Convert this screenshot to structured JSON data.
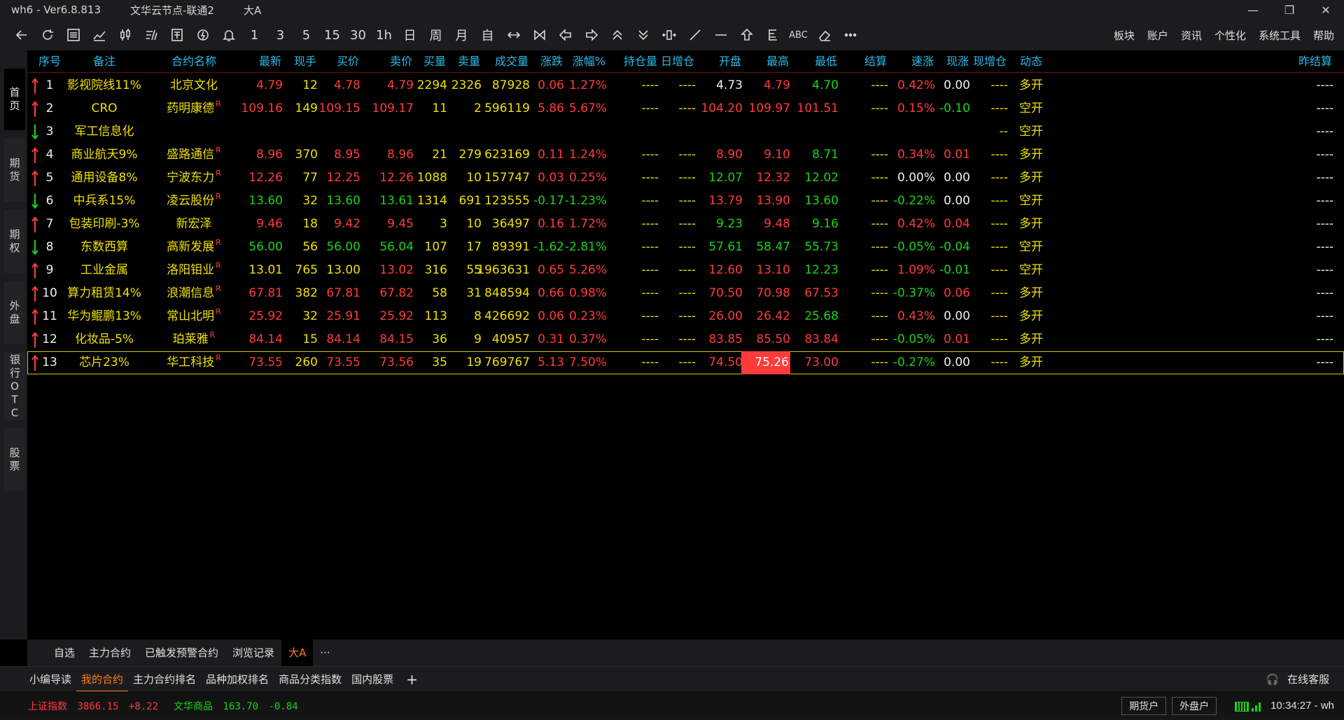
{
  "titlebar": {
    "app": "wh6 - Ver6.8.813",
    "node": "文华云节点-联通2",
    "group": "大A",
    "minimize": "—",
    "maximize": "❐",
    "close": "✕"
  },
  "toolbar": {
    "numeric_buttons": [
      "1",
      "3",
      "5",
      "15",
      "30",
      "1h",
      "日",
      "周",
      "月",
      "自"
    ],
    "text_button": "ABC",
    "menu": [
      "板块",
      "账户",
      "资讯",
      "个性化",
      "系统工具",
      "帮助"
    ]
  },
  "sidetabs": [
    "首页",
    "期货",
    "期权",
    "外盘",
    "银行OTC",
    "股票"
  ],
  "table": {
    "headers": [
      "序号",
      "备注",
      "合约名称",
      "最新",
      "现手",
      "买价",
      "卖价",
      "买量",
      "卖量",
      "成交量",
      "涨跌",
      "涨幅%",
      "持仓量",
      "日增仓",
      "开盘",
      "最高",
      "最低",
      "结算",
      "速涨",
      "现涨",
      "现增仓",
      "动态",
      "昨结算"
    ],
    "rows": [
      {
        "dir": "up",
        "no": "1",
        "note": "影视院线11%",
        "name": "北京文化",
        "r": false,
        "last": "4.79",
        "vol_now": "12",
        "bid": "4.78",
        "ask": "4.79",
        "bidv": "2294",
        "askv": "2326",
        "volume": "87928",
        "chg": "0.06",
        "pct": "1.27%",
        "oi": "----",
        "oi_chg": "----",
        "open": "4.73",
        "high": "4.79",
        "low": "4.70",
        "settle": "----",
        "speed": "0.42%",
        "now_chg": "0.00",
        "now_oi": "----",
        "dyn": "多开",
        "pre": "----",
        "c": {
          "last": "red",
          "bid": "red",
          "ask": "red",
          "chg": "red",
          "pct": "red",
          "open": "wht",
          "high": "red",
          "low": "green",
          "speed": "red",
          "now_chg": "wht"
        }
      },
      {
        "dir": "up",
        "no": "2",
        "note": "CRO",
        "name": "药明康德",
        "r": true,
        "last": "109.16",
        "vol_now": "149",
        "bid": "109.15",
        "ask": "109.17",
        "bidv": "11",
        "askv": "2",
        "volume": "596119",
        "chg": "5.86",
        "pct": "5.67%",
        "oi": "----",
        "oi_chg": "----",
        "open": "104.20",
        "high": "109.97",
        "low": "101.51",
        "settle": "----",
        "speed": "0.15%",
        "now_chg": "-0.10",
        "now_oi": "----",
        "dyn": "空开",
        "pre": "----",
        "c": {
          "last": "red",
          "bid": "red",
          "ask": "red",
          "chg": "red",
          "pct": "red",
          "open": "red",
          "high": "red",
          "low": "red",
          "speed": "red",
          "now_chg": "green"
        }
      },
      {
        "dir": "down",
        "no": "3",
        "note": "军工信息化",
        "name": "",
        "r": false,
        "last": "",
        "vol_now": "",
        "bid": "",
        "ask": "",
        "bidv": "",
        "askv": "",
        "volume": "",
        "chg": "",
        "pct": "",
        "oi": "",
        "oi_chg": "",
        "open": "",
        "high": "",
        "low": "",
        "settle": "",
        "speed": "",
        "now_chg": "",
        "now_oi": "--",
        "dyn": "空开",
        "pre": "----",
        "c": {}
      },
      {
        "dir": "up",
        "no": "4",
        "note": "商业航天9%",
        "name": "盛路通信",
        "r": true,
        "last": "8.96",
        "vol_now": "370",
        "bid": "8.95",
        "ask": "8.96",
        "bidv": "21",
        "askv": "279",
        "volume": "623169",
        "chg": "0.11",
        "pct": "1.24%",
        "oi": "----",
        "oi_chg": "----",
        "open": "8.90",
        "high": "9.10",
        "low": "8.71",
        "settle": "----",
        "speed": "0.34%",
        "now_chg": "0.01",
        "now_oi": "----",
        "dyn": "多开",
        "pre": "----",
        "c": {
          "last": "red",
          "bid": "red",
          "ask": "red",
          "chg": "red",
          "pct": "red",
          "open": "red",
          "high": "red",
          "low": "green",
          "speed": "red",
          "now_chg": "red"
        }
      },
      {
        "dir": "up",
        "no": "5",
        "note": "通用设备8%",
        "name": "宁波东力",
        "r": true,
        "last": "12.26",
        "vol_now": "77",
        "bid": "12.25",
        "ask": "12.26",
        "bidv": "1088",
        "askv": "10",
        "volume": "157747",
        "chg": "0.03",
        "pct": "0.25%",
        "oi": "----",
        "oi_chg": "----",
        "open": "12.07",
        "high": "12.32",
        "low": "12.02",
        "settle": "----",
        "speed": "0.00%",
        "now_chg": "0.00",
        "now_oi": "----",
        "dyn": "多开",
        "pre": "----",
        "c": {
          "last": "red",
          "bid": "red",
          "ask": "red",
          "chg": "red",
          "pct": "red",
          "open": "green",
          "high": "red",
          "low": "green",
          "speed": "wht",
          "now_chg": "wht"
        }
      },
      {
        "dir": "down",
        "no": "6",
        "note": "中兵系15%",
        "name": "凌云股份",
        "r": true,
        "last": "13.60",
        "vol_now": "32",
        "bid": "13.60",
        "ask": "13.61",
        "bidv": "1314",
        "askv": "691",
        "volume": "123555",
        "chg": "-0.17",
        "pct": "-1.23%",
        "oi": "----",
        "oi_chg": "----",
        "open": "13.79",
        "high": "13.90",
        "low": "13.60",
        "settle": "----",
        "speed": "-0.22%",
        "now_chg": "0.00",
        "now_oi": "----",
        "dyn": "空开",
        "pre": "----",
        "c": {
          "last": "green",
          "bid": "green",
          "ask": "green",
          "chg": "green",
          "pct": "green",
          "open": "red",
          "high": "red",
          "low": "green",
          "speed": "green",
          "now_chg": "wht"
        }
      },
      {
        "dir": "up",
        "no": "7",
        "note": "包装印刷-3%",
        "name": "新宏泽",
        "r": false,
        "last": "9.46",
        "vol_now": "18",
        "bid": "9.42",
        "ask": "9.45",
        "bidv": "3",
        "askv": "10",
        "volume": "36497",
        "chg": "0.16",
        "pct": "1.72%",
        "oi": "----",
        "oi_chg": "----",
        "open": "9.23",
        "high": "9.48",
        "low": "9.16",
        "settle": "----",
        "speed": "0.42%",
        "now_chg": "0.04",
        "now_oi": "----",
        "dyn": "多开",
        "pre": "----",
        "c": {
          "last": "red",
          "bid": "red",
          "ask": "red",
          "chg": "red",
          "pct": "red",
          "open": "green",
          "high": "red",
          "low": "green",
          "speed": "red",
          "now_chg": "red"
        }
      },
      {
        "dir": "down",
        "no": "8",
        "note": "东数西算",
        "name": "高新发展",
        "r": true,
        "last": "56.00",
        "vol_now": "56",
        "bid": "56.00",
        "ask": "56.04",
        "bidv": "107",
        "askv": "17",
        "volume": "89391",
        "chg": "-1.62",
        "pct": "-2.81%",
        "oi": "----",
        "oi_chg": "----",
        "open": "57.61",
        "high": "58.47",
        "low": "55.73",
        "settle": "----",
        "speed": "-0.05%",
        "now_chg": "-0.04",
        "now_oi": "----",
        "dyn": "空开",
        "pre": "----",
        "c": {
          "last": "green",
          "bid": "green",
          "ask": "green",
          "chg": "green",
          "pct": "green",
          "open": "green",
          "high": "green",
          "low": "green",
          "speed": "green",
          "now_chg": "green"
        }
      },
      {
        "dir": "up",
        "no": "9",
        "note": "工业金属",
        "name": "洛阳钼业",
        "r": true,
        "last": "13.01",
        "vol_now": "765",
        "bid": "13.00",
        "ask": "13.02",
        "bidv": "316",
        "askv": "55",
        "volume": "1963631",
        "chg": "0.65",
        "pct": "5.26%",
        "oi": "----",
        "oi_chg": "----",
        "open": "12.60",
        "high": "13.10",
        "low": "12.23",
        "settle": "----",
        "speed": "1.09%",
        "now_chg": "-0.01",
        "now_oi": "----",
        "dyn": "空开",
        "pre": "----",
        "c": {
          "last": "yel",
          "bid": "yel",
          "ask": "red",
          "chg": "red",
          "pct": "red",
          "open": "red",
          "high": "red",
          "low": "green",
          "speed": "red",
          "now_chg": "green"
        }
      },
      {
        "dir": "up",
        "no": "10",
        "note": "算力租赁14%",
        "name": "浪潮信息",
        "r": true,
        "last": "67.81",
        "vol_now": "382",
        "bid": "67.81",
        "ask": "67.82",
        "bidv": "58",
        "askv": "31",
        "volume": "848594",
        "chg": "0.66",
        "pct": "0.98%",
        "oi": "----",
        "oi_chg": "----",
        "open": "70.50",
        "high": "70.98",
        "low": "67.53",
        "settle": "----",
        "speed": "-0.37%",
        "now_chg": "0.06",
        "now_oi": "----",
        "dyn": "多开",
        "pre": "----",
        "c": {
          "last": "red",
          "bid": "red",
          "ask": "red",
          "chg": "red",
          "pct": "red",
          "open": "red",
          "high": "red",
          "low": "red",
          "speed": "green",
          "now_chg": "red"
        }
      },
      {
        "dir": "up",
        "no": "11",
        "note": "华为鲲鹏13%",
        "name": "常山北明",
        "r": true,
        "last": "25.92",
        "vol_now": "32",
        "bid": "25.91",
        "ask": "25.92",
        "bidv": "113",
        "askv": "8",
        "volume": "426692",
        "chg": "0.06",
        "pct": "0.23%",
        "oi": "----",
        "oi_chg": "----",
        "open": "26.00",
        "high": "26.42",
        "low": "25.68",
        "settle": "----",
        "speed": "0.43%",
        "now_chg": "0.00",
        "now_oi": "----",
        "dyn": "多开",
        "pre": "----",
        "c": {
          "last": "red",
          "bid": "red",
          "ask": "red",
          "chg": "red",
          "pct": "red",
          "open": "red",
          "high": "red",
          "low": "green",
          "speed": "red",
          "now_chg": "wht"
        }
      },
      {
        "dir": "up",
        "no": "12",
        "note": "化妆品-5%",
        "name": "珀莱雅",
        "r": true,
        "last": "84.14",
        "vol_now": "15",
        "bid": "84.14",
        "ask": "84.15",
        "bidv": "36",
        "askv": "9",
        "volume": "40957",
        "chg": "0.31",
        "pct": "0.37%",
        "oi": "----",
        "oi_chg": "----",
        "open": "83.85",
        "high": "85.50",
        "low": "83.84",
        "settle": "----",
        "speed": "-0.05%",
        "now_chg": "0.01",
        "now_oi": "----",
        "dyn": "多开",
        "pre": "----",
        "c": {
          "last": "red",
          "bid": "red",
          "ask": "red",
          "chg": "red",
          "pct": "red",
          "open": "red",
          "high": "red",
          "low": "red",
          "speed": "green",
          "now_chg": "red"
        }
      },
      {
        "dir": "up",
        "no": "13",
        "note": "芯片23%",
        "name": "华工科技",
        "r": true,
        "last": "73.55",
        "vol_now": "260",
        "bid": "73.55",
        "ask": "73.56",
        "bidv": "35",
        "askv": "19",
        "volume": "769767",
        "chg": "5.13",
        "pct": "7.50%",
        "oi": "----",
        "oi_chg": "----",
        "open": "74.50",
        "high": "75.26",
        "low": "73.00",
        "settle": "----",
        "speed": "-0.27%",
        "now_chg": "0.00",
        "now_oi": "----",
        "dyn": "多开",
        "pre": "----",
        "c": {
          "last": "red",
          "bid": "red",
          "ask": "red",
          "chg": "red",
          "pct": "red",
          "open": "red",
          "high": "hl",
          "low": "red",
          "speed": "green",
          "now_chg": "wht"
        },
        "selected": true
      }
    ]
  },
  "bottom_tabs": [
    "自选",
    "主力合约",
    "已触发预警合约",
    "浏览记录",
    "大A",
    "···"
  ],
  "bottom_tabs_active": 4,
  "sub_tabs": [
    "小编导读",
    "我的合约",
    "主力合约排名",
    "品种加权排名",
    "商品分类指数",
    "国内股票",
    "+"
  ],
  "sub_tabs_active": 1,
  "service": "在线客服",
  "status": {
    "idx1_name": "上证指数",
    "idx1_value": "3866.15",
    "idx1_chg": "+8.22",
    "idx2_name": "文华商品",
    "idx2_value": "163.70",
    "idx2_chg": "-0.84",
    "btn_futures": "期货户",
    "btn_overseas": "外盘户",
    "clock": "10:34:27 - wh"
  },
  "colors": {
    "up": "#ff3b3b",
    "down": "#19d419",
    "header": "#29b8e8",
    "accent": "#ff7f1a",
    "name": "#f0e000"
  }
}
